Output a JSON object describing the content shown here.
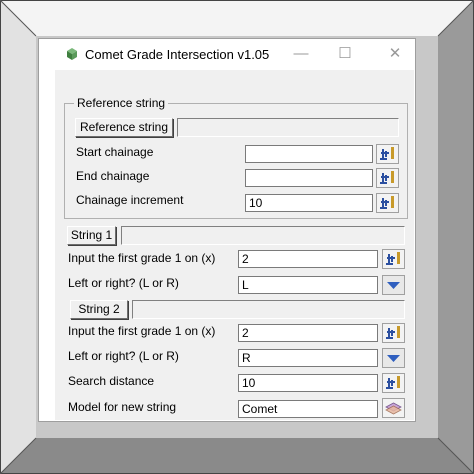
{
  "window": {
    "title": "Comet Grade Intersection v1.05",
    "minimize_icon": "minimize-icon",
    "maximize_icon": "maximize-icon",
    "close_icon": "close-icon"
  },
  "reference": {
    "group_label": "Reference string",
    "button_label": "Reference string",
    "start_label": "Start chainage",
    "start_value": "",
    "end_label": "End chainage",
    "end_value": "",
    "increment_label": "Chainage increment",
    "increment_value": "10"
  },
  "string1": {
    "button_label": "String 1",
    "grade_label": "Input the first grade 1 on (x)",
    "grade_value": "2",
    "side_label": "Left or right? (L or R)",
    "side_value": "L"
  },
  "string2": {
    "button_label": "String 2",
    "grade_label": "Input the first grade 1 on (x)",
    "grade_value": "2",
    "side_label": "Left or right? (L or R)",
    "side_value": "R",
    "search_label": "Search distance",
    "search_value": "10",
    "model_label": "Model for new string",
    "model_value": "Comet"
  },
  "colors": {
    "pick_icon": "#2b4fa0",
    "pick_accent": "#c89a2a",
    "combo_arrow": "#2f5fbf"
  }
}
